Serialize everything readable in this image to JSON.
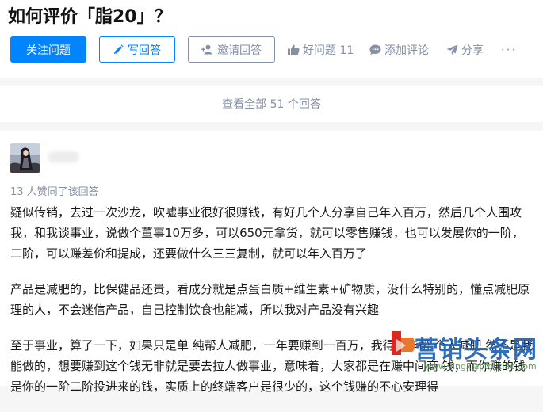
{
  "question": {
    "title": "如何评价「脂20」？"
  },
  "header": {
    "follow_label": "关注问题",
    "write_label": "写回答",
    "invite_label": "邀请回答",
    "good_question_label": "好问题 11",
    "comment_label": "添加评论",
    "share_label": "分享",
    "more_label": "···"
  },
  "view_all": {
    "label": "查看全部 51 个回答"
  },
  "answer": {
    "upvote_note": "13 人赞同了该回答",
    "paragraphs": [
      "疑似传销，去过一次沙龙，吹嘘事业很好很赚钱，有好几个人分享自己年入百万，然后几个人围攻我，和我谈事业，说做个董事10万多，可以650元拿货，就可以零售赚钱，也可以发展你的一阶，二阶，可以赚差价和提成，还要做什么三三复制，就可以年入百万了",
      "产品是减肥的，比保健品还贵，看成分就是点蛋白质+维生素+矿物质，没什么特别的，懂点减肥原理的人，不会迷信产品，自己控制饮食也能减，所以我对产品没有兴趣",
      "至于事业，算了一下，如果只是单 纯帮人减肥，一年要赚到一百万，我得一年帮 个人减肥 然不是我能做的，想要赚到这个钱无非就是要去拉人做事业，意味着，大家都是在赚中间商 钱，而你赚的钱是你的一阶二阶投进来的钱，实质上的终端客户是很少的，这个钱赚的不心安理得"
    ]
  },
  "watermark": {
    "text": "营销头条网",
    "url": "www.yingxiaotoutiao.com"
  },
  "colors": {
    "primary": "#0084ff",
    "muted": "#8590a6",
    "text": "#1a1a1a"
  }
}
